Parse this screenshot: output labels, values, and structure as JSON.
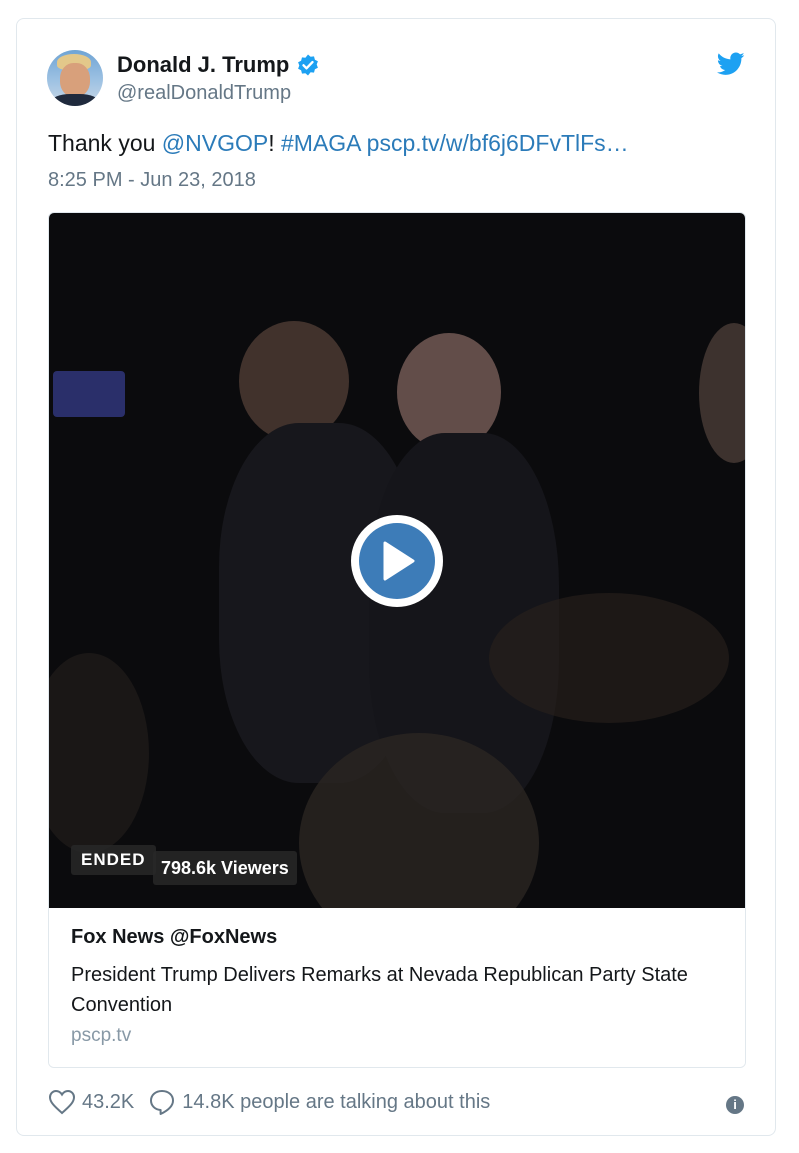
{
  "author": {
    "name": "Donald J. Trump",
    "handle": "@realDonaldTrump"
  },
  "tweet": {
    "text_prefix": "Thank you ",
    "mention": "@NVGOP",
    "exclaim": "!",
    "hashtag": "#MAGA",
    "link": "pscp.tv/w/bf6j6DFvTlFs…",
    "timestamp": "8:25 PM - Jun 23, 2018"
  },
  "media": {
    "status_badge": "ENDED",
    "viewers": "798.6k Viewers",
    "source": "Fox News @FoxNews",
    "title": "President Trump Delivers Remarks at Nevada Republican Party State Convention",
    "domain": "pscp.tv"
  },
  "footer": {
    "likes": "43.2K",
    "talking": "14.8K people are talking about this"
  },
  "colors": {
    "link": "#2b7bb9",
    "twitter_blue": "#1da1f2",
    "verified": "#1da1f2",
    "play_button": "#3d7cb8"
  },
  "icons": [
    "verified-badge-icon",
    "twitter-bird-icon",
    "play-icon",
    "heart-icon",
    "comment-icon",
    "info-icon"
  ]
}
